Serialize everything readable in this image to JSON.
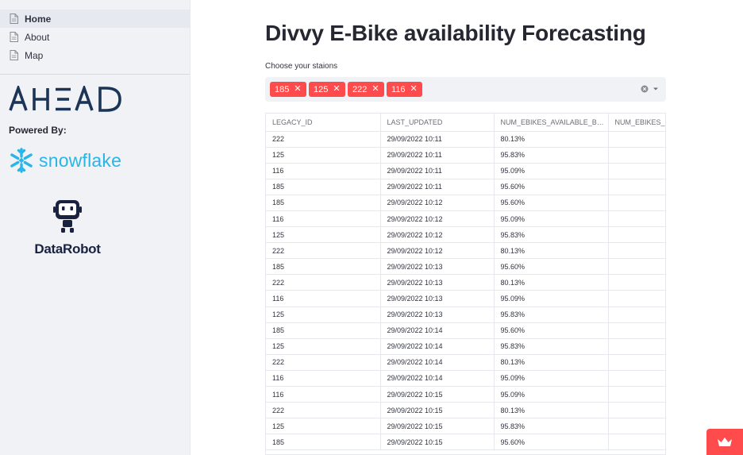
{
  "nav": {
    "items": [
      {
        "label": "Home"
      },
      {
        "label": "About"
      },
      {
        "label": "Map"
      }
    ]
  },
  "logos": {
    "ahead": "AHEAD",
    "snowflake": "snowflake",
    "datarobot": "DataRobot"
  },
  "powered_by": "Powered By:",
  "main": {
    "title": "Divvy E-Bike availability Forecasting",
    "select_label": "Choose your staions",
    "selected_tags": [
      "185",
      "125",
      "222",
      "116"
    ]
  },
  "table": {
    "columns": [
      "LEGACY_ID",
      "LAST_UPDATED",
      "NUM_EBIKES_AVAILABLE_B…",
      "NUM_EBIKES_"
    ],
    "rows": [
      [
        "222",
        "29/09/2022 10:11",
        "80.13%",
        ""
      ],
      [
        "125",
        "29/09/2022 10:11",
        "95.83%",
        ""
      ],
      [
        "116",
        "29/09/2022 10:11",
        "95.09%",
        ""
      ],
      [
        "185",
        "29/09/2022 10:11",
        "95.60%",
        ""
      ],
      [
        "185",
        "29/09/2022 10:12",
        "95.60%",
        ""
      ],
      [
        "116",
        "29/09/2022 10:12",
        "95.09%",
        ""
      ],
      [
        "125",
        "29/09/2022 10:12",
        "95.83%",
        ""
      ],
      [
        "222",
        "29/09/2022 10:12",
        "80.13%",
        ""
      ],
      [
        "185",
        "29/09/2022 10:13",
        "95.60%",
        ""
      ],
      [
        "222",
        "29/09/2022 10:13",
        "80.13%",
        ""
      ],
      [
        "116",
        "29/09/2022 10:13",
        "95.09%",
        ""
      ],
      [
        "125",
        "29/09/2022 10:13",
        "95.83%",
        ""
      ],
      [
        "185",
        "29/09/2022 10:14",
        "95.60%",
        ""
      ],
      [
        "125",
        "29/09/2022 10:14",
        "95.83%",
        ""
      ],
      [
        "222",
        "29/09/2022 10:14",
        "80.13%",
        ""
      ],
      [
        "116",
        "29/09/2022 10:14",
        "95.09%",
        ""
      ],
      [
        "116",
        "29/09/2022 10:15",
        "95.09%",
        ""
      ],
      [
        "222",
        "29/09/2022 10:15",
        "80.13%",
        ""
      ],
      [
        "125",
        "29/09/2022 10:15",
        "95.83%",
        ""
      ],
      [
        "185",
        "29/09/2022 10:15",
        "95.60%",
        ""
      ]
    ]
  },
  "colors": {
    "accent": "#ff4b4b",
    "sidebar_bg": "#f0f2f6",
    "ahead_blue": "#1c3557",
    "snowflake_blue": "#29b5e8"
  },
  "icons": {
    "nav": "document-icon",
    "tag_remove": "close-icon",
    "clear": "clear-icon",
    "dropdown": "chevron-down-icon",
    "corner": "crown-icon"
  }
}
